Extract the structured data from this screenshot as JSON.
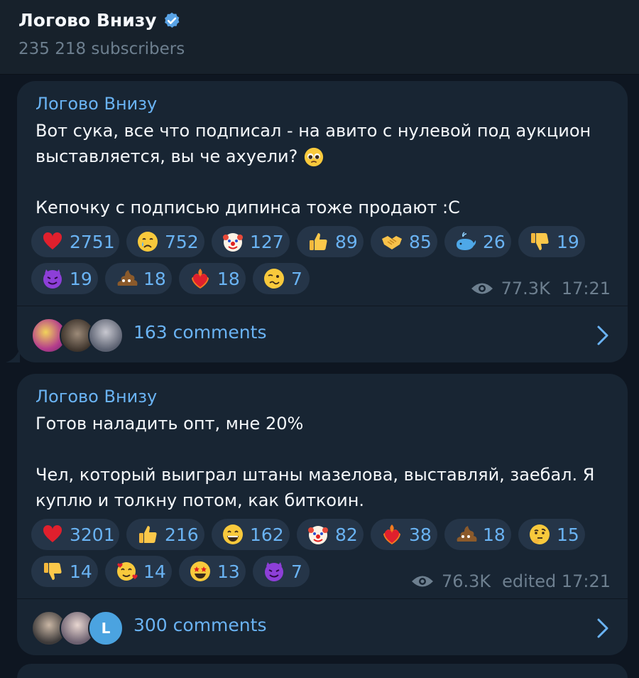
{
  "header": {
    "channel_name": "Логово Внизу",
    "subscribers": "235 218 subscribers"
  },
  "posts": [
    {
      "author": "Логово Внизу",
      "text_1": "Вот сука, все что подписал - на авито с нулевой под аукцион\nвыставляется, вы че ахуели? ",
      "text_2": "Кепочку с подписью дипинса тоже продают :С",
      "reactions": [
        {
          "icon": "red-heart-icon",
          "count": "2751"
        },
        {
          "icon": "crying-face-icon",
          "count": "752"
        },
        {
          "icon": "clown-face-icon",
          "count": "127"
        },
        {
          "icon": "thumbs-up-icon",
          "count": "89"
        },
        {
          "icon": "handshake-icon",
          "count": "85"
        },
        {
          "icon": "whale-icon",
          "count": "26"
        },
        {
          "icon": "thumbs-down-icon",
          "count": "19"
        },
        {
          "icon": "smiling-devil-icon",
          "count": "19"
        },
        {
          "icon": "poop-icon",
          "count": "18"
        },
        {
          "icon": "heart-on-fire-icon",
          "count": "18"
        },
        {
          "icon": "woozy-face-icon",
          "count": "7"
        }
      ],
      "views": "77.3K",
      "time": "17:21",
      "comments": "163 comments"
    },
    {
      "author": "Логово Внизу",
      "text_1": "Готов наладить опт, мне 20%",
      "text_2": "Чел, который выиграл штаны мазелова, выставляй, заебал. Я\nкуплю и толкну потом, как биткоин.",
      "reactions": [
        {
          "icon": "red-heart-icon",
          "count": "3201"
        },
        {
          "icon": "thumbs-up-icon",
          "count": "216"
        },
        {
          "icon": "grinning-face-icon",
          "count": "162"
        },
        {
          "icon": "clown-face-icon",
          "count": "82"
        },
        {
          "icon": "heart-on-fire-icon",
          "count": "38"
        },
        {
          "icon": "poop-icon",
          "count": "18"
        },
        {
          "icon": "thinking-face-icon",
          "count": "15"
        },
        {
          "icon": "thumbs-down-icon",
          "count": "14"
        },
        {
          "icon": "smiling-face-hearts-icon",
          "count": "14"
        },
        {
          "icon": "star-struck-icon",
          "count": "13"
        },
        {
          "icon": "smiling-devil-icon",
          "count": "7"
        }
      ],
      "views": "76.3K",
      "time": "edited 17:21",
      "comments": "300 comments",
      "avatar_letter": "L"
    }
  ],
  "colors": {
    "background": "#0e1621",
    "bubble": "#182533",
    "accent": "#6ab3f3",
    "muted": "#6d7f8f"
  }
}
